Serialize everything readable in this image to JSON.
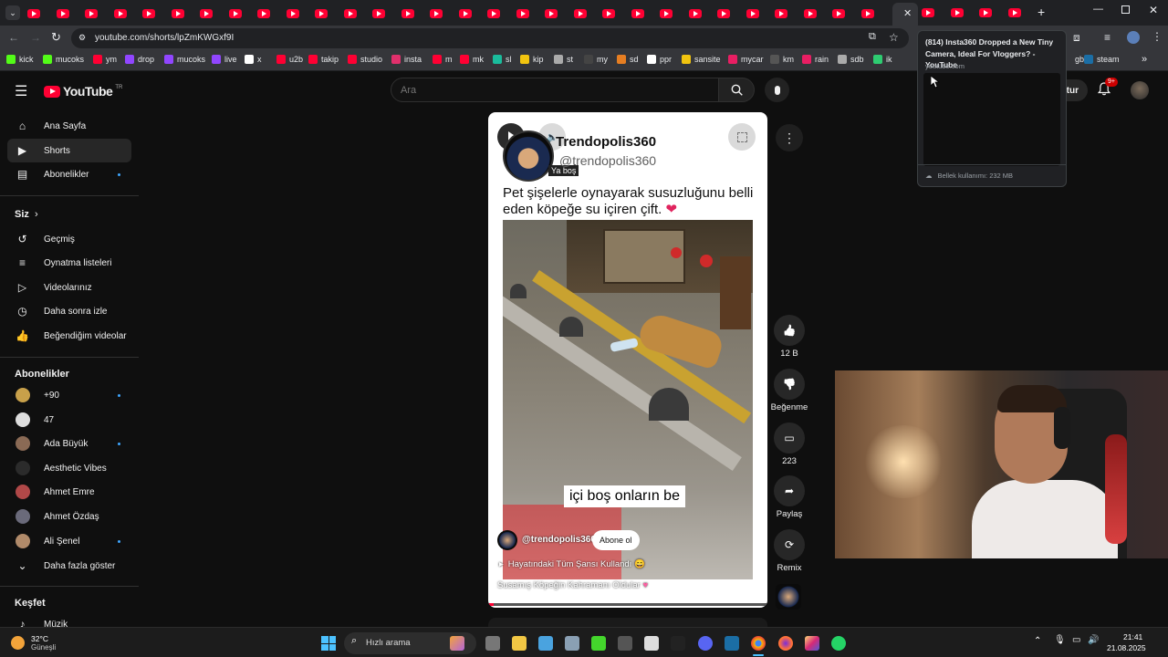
{
  "browser": {
    "url": "youtube.com/shorts/lpZmKWGxf9I",
    "tab_count": 34,
    "tooltip": {
      "title": "(814) Insta360 Dropped a New Tiny Camera, Ideal For Vloggers? - YouTube",
      "domain": "youtube.com",
      "memory": "Bellek kullanımı: 232 MB"
    }
  },
  "bookmarks": [
    {
      "label": "kick",
      "color": "#53fc18"
    },
    {
      "label": "mucoks",
      "color": "#53fc18"
    },
    {
      "label": "ym",
      "color": "#ff0033"
    },
    {
      "label": "drop",
      "color": "#9146ff"
    },
    {
      "label": "mucoks",
      "color": "#9146ff"
    },
    {
      "label": "live",
      "color": "#9146ff"
    },
    {
      "label": "x",
      "color": "#ffffff"
    },
    {
      "label": "u2b",
      "color": "#ff0033"
    },
    {
      "label": "takip",
      "color": "#ff0033"
    },
    {
      "label": "studio",
      "color": "#ff0033"
    },
    {
      "label": "insta",
      "color": "#e1306c"
    },
    {
      "label": "m",
      "color": "#ff0033"
    },
    {
      "label": "mk",
      "color": "#ff0033"
    },
    {
      "label": "sl",
      "color": "#1abc9c"
    },
    {
      "label": "kip",
      "color": "#f1c40f"
    },
    {
      "label": "st",
      "color": "#aaaaaa"
    },
    {
      "label": "my",
      "color": "#444444"
    },
    {
      "label": "sd",
      "color": "#e67e22"
    },
    {
      "label": "ppr",
      "color": "#ffffff"
    },
    {
      "label": "sansite",
      "color": "#f1c40f"
    },
    {
      "label": "mycar",
      "color": "#e91e63"
    },
    {
      "label": "km",
      "color": "#555555"
    },
    {
      "label": "rain",
      "color": "#e91e63"
    },
    {
      "label": "sdb",
      "color": "#aaaaaa"
    },
    {
      "label": "ik",
      "color": "#2ecc71"
    },
    {
      "label": "gb",
      "color": "#555555"
    },
    {
      "label": "steam",
      "color": "#1b6ea5"
    }
  ],
  "youtube": {
    "logo_text": "YouTube",
    "logo_region": "TR",
    "search_placeholder": "Ara",
    "create_label": "Oluştur",
    "notification_count": "9+"
  },
  "sidebar": {
    "main": [
      {
        "label": "Ana Sayfa",
        "icon": "home-icon"
      },
      {
        "label": "Shorts",
        "icon": "shorts-icon",
        "active": true
      },
      {
        "label": "Abonelikler",
        "icon": "subscriptions-icon",
        "dot": true
      }
    ],
    "you_title": "Siz",
    "you": [
      {
        "label": "Geçmiş",
        "icon": "history-icon"
      },
      {
        "label": "Oynatma listeleri",
        "icon": "playlists-icon"
      },
      {
        "label": "Videolarınız",
        "icon": "your-videos-icon"
      },
      {
        "label": "Daha sonra izle",
        "icon": "watch-later-icon"
      },
      {
        "label": "Beğendiğim videolar",
        "icon": "liked-icon"
      }
    ],
    "subs_title": "Abonelikler",
    "subs": [
      {
        "label": "+90",
        "color": "#c8a04a",
        "dot": true
      },
      {
        "label": "47",
        "color": "#dddddd",
        "dot": false
      },
      {
        "label": "Ada Büyük",
        "color": "#8a6a55",
        "dot": true
      },
      {
        "label": "Aesthetic Vibes",
        "color": "#2b2b2b",
        "dot": false
      },
      {
        "label": "Ahmet Emre",
        "color": "#b04848",
        "dot": false
      },
      {
        "label": "Ahmet Özdaş",
        "color": "#6a6a7a",
        "dot": false
      },
      {
        "label": "Ali Şenel",
        "color": "#b08a6a",
        "dot": true
      }
    ],
    "show_more": "Daha fazla göster",
    "explore_title": "Keşfet",
    "explore": [
      {
        "label": "Müzik",
        "icon": "music-icon"
      }
    ]
  },
  "short": {
    "channel_title": "Trendopolis360",
    "channel_handle": "@trendopolis360",
    "avatar_caption": "Ya boş",
    "caption": "Pet şişelerle oynayarak susuzluğunu belli eden köpeğe su içiren çift.",
    "subtitle": "içi boş onların be",
    "overlay_channel": "@trendopolis360",
    "subscribe_label": "Abone ol",
    "music": "Hayatındaki Tüm Şansı Kullandı 😄",
    "title": "Susamış Köpeğin Kahramanı Oldular"
  },
  "actions": [
    {
      "label": "12 B",
      "icon": "like-icon"
    },
    {
      "label": "Beğenme",
      "icon": "dislike-icon"
    },
    {
      "label": "223",
      "icon": "comment-icon"
    },
    {
      "label": "Paylaş",
      "icon": "share-icon"
    },
    {
      "label": "Remix",
      "icon": "remix-icon"
    }
  ],
  "taskbar": {
    "weather_temp": "32°C",
    "weather_desc": "Güneşli",
    "search_label": "Hızlı arama",
    "time": "21:41",
    "date": "21.08.2025"
  }
}
